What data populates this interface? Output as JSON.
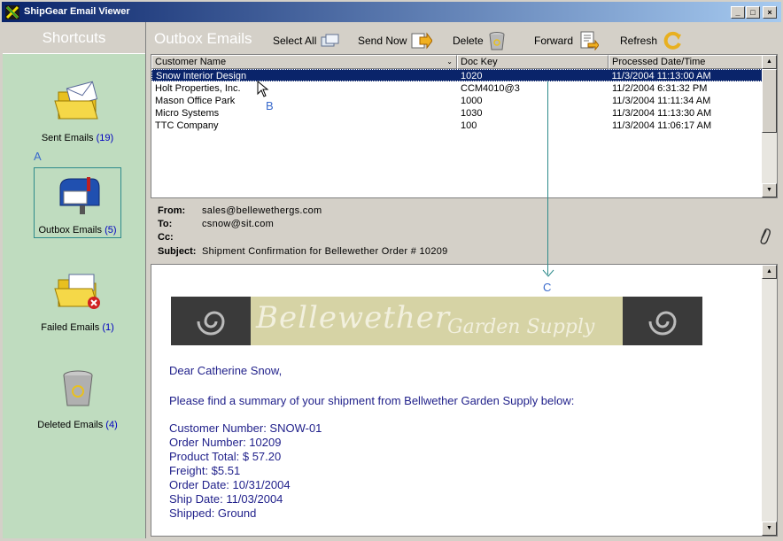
{
  "window": {
    "title": "ShipGear Email Viewer",
    "buttons": [
      "_",
      "□",
      "×"
    ]
  },
  "sidebar": {
    "title": "Shortcuts",
    "items": [
      {
        "label": "Sent Emails",
        "count": "(19)",
        "icon": "open-folder-envelope-icon"
      },
      {
        "label": "Outbox Emails",
        "count": "(5)",
        "icon": "mailbox-icon"
      },
      {
        "label": "Failed Emails",
        "count": "(1)",
        "icon": "folder-error-icon"
      },
      {
        "label": "Deleted Emails",
        "count": "(4)",
        "icon": "trash-can-icon"
      }
    ]
  },
  "toolbar": {
    "title": "Outbox Emails",
    "select_all": "Select All",
    "send_now": "Send Now",
    "delete": "Delete",
    "forward": "Forward",
    "refresh": "Refresh"
  },
  "grid": {
    "columns": [
      "Customer Name",
      "Doc Key",
      "Processed Date/Time"
    ],
    "rows": [
      [
        "Snow Interior Design",
        "1020",
        "11/3/2004 11:13:00 AM"
      ],
      [
        "Holt Properties, Inc.",
        "CCM4010@3",
        "11/2/2004 6:31:32 PM"
      ],
      [
        "Mason Office Park",
        "1000",
        "11/3/2004 11:11:34 AM"
      ],
      [
        "Micro Systems",
        "1030",
        "11/3/2004 11:13:30 AM"
      ],
      [
        "TTC Company",
        "100",
        "11/3/2004 11:06:17 AM"
      ]
    ],
    "selected_row": 0
  },
  "email": {
    "from_label": "From:",
    "from": "sales@bellewethergs.com",
    "to_label": "To:",
    "to": "csnow@sit.com",
    "cc_label": "Cc:",
    "cc": "",
    "subject_label": "Subject:",
    "subject": "Shipment Confirmation for Bellewether Order # 10209",
    "banner_line1": "Bellewether",
    "banner_line2": "Garden Supply",
    "body": [
      "Dear Catherine Snow,",
      "Please find a summary of your shipment from Bellwether Garden Supply below:",
      "Customer Number: SNOW-01",
      "Order Number: 10209",
      "Product Total: $ 57.20",
      "Freight: $5.51",
      "Order Date: 10/31/2004",
      "Ship Date: 11/03/2004",
      "Shipped: Ground"
    ]
  },
  "annotations": {
    "a": "A",
    "b": "B",
    "c": "C"
  },
  "colors": {
    "sidebar": "#bfdcbf",
    "selection": "#0a246a",
    "body_text": "#1f1f8a"
  }
}
